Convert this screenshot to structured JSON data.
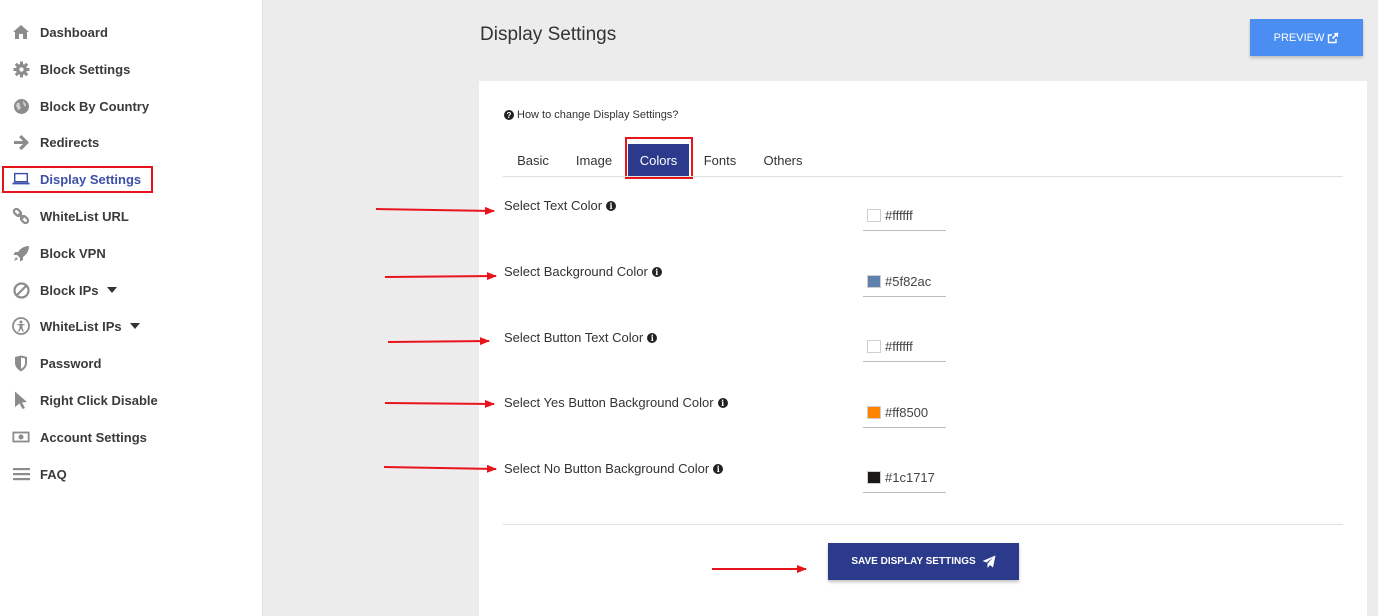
{
  "sidebar": {
    "items": [
      {
        "label": "Dashboard",
        "icon": "home-icon"
      },
      {
        "label": "Block Settings",
        "icon": "gear-icon"
      },
      {
        "label": "Block By Country",
        "icon": "globe-icon"
      },
      {
        "label": "Redirects",
        "icon": "arrow-right-icon"
      },
      {
        "label": "Display Settings",
        "icon": "laptop-icon",
        "active": true
      },
      {
        "label": "WhiteList URL",
        "icon": "link-icon"
      },
      {
        "label": "Block VPN",
        "icon": "rocket-icon"
      },
      {
        "label": "Block IPs",
        "icon": "ban-icon",
        "dropdown": true
      },
      {
        "label": "WhiteList IPs",
        "icon": "accessibility-icon",
        "dropdown": true
      },
      {
        "label": "Password",
        "icon": "shield-icon"
      },
      {
        "label": "Right Click Disable",
        "icon": "cursor-icon"
      },
      {
        "label": "Account Settings",
        "icon": "money-icon"
      },
      {
        "label": "FAQ",
        "icon": "bars-icon"
      }
    ]
  },
  "header": {
    "title": "Display Settings",
    "preview_label": "PREVIEW"
  },
  "help": {
    "text": "How to change Display Settings?"
  },
  "tabs": [
    {
      "label": "Basic"
    },
    {
      "label": "Image"
    },
    {
      "label": "Colors",
      "active": true
    },
    {
      "label": "Fonts"
    },
    {
      "label": "Others"
    }
  ],
  "color_settings": [
    {
      "label": "Select Text Color",
      "value": "#ffffff",
      "swatch": "#ffffff"
    },
    {
      "label": "Select Background Color",
      "value": "#5f82ac",
      "swatch": "#5f82ac"
    },
    {
      "label": "Select Button Text Color",
      "value": "#ffffff",
      "swatch": "#ffffff"
    },
    {
      "label": "Select Yes Button Background Color",
      "value": "#ff8500",
      "swatch": "#ff8500"
    },
    {
      "label": "Select No Button Background Color",
      "value": "#1c1717",
      "swatch": "#1c1717"
    }
  ],
  "save_label": "SAVE DISPLAY SETTINGS",
  "colors": {
    "accent": "#2b3a8b",
    "preview_button": "#4a8ef1",
    "annotation": "#e8141c",
    "active_nav": "#3e4fa8"
  }
}
